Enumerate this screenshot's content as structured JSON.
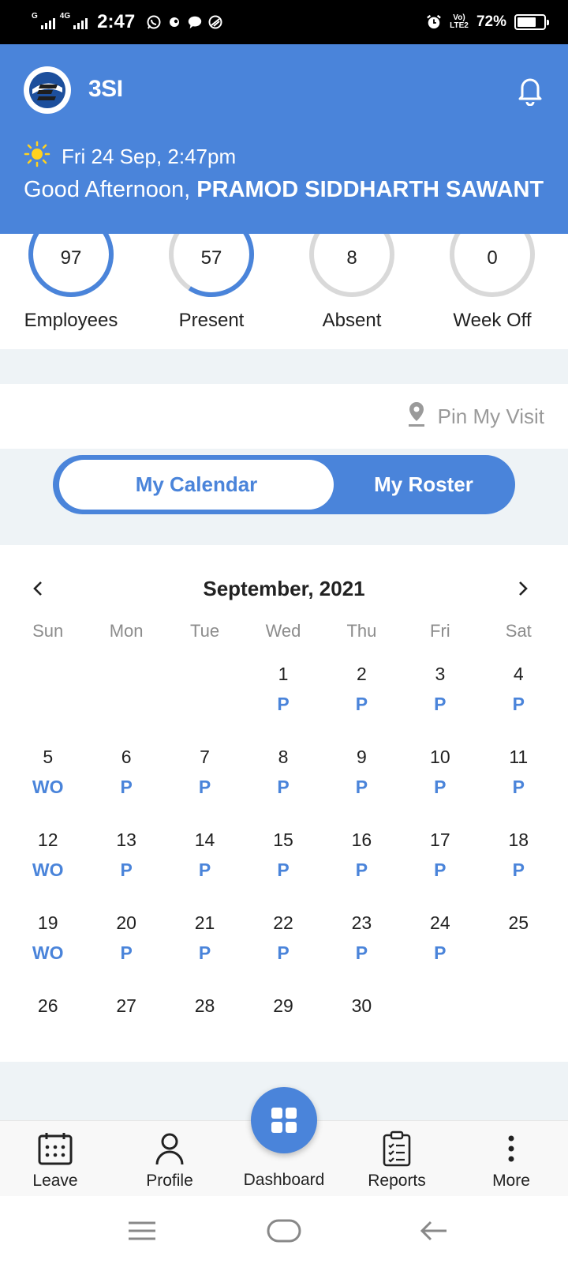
{
  "status_bar": {
    "network_1": "G",
    "network_2": "4G",
    "time": "2:47",
    "volte": "Vo) LTE2",
    "battery": "72%",
    "battery_level": 0.72
  },
  "header": {
    "app_name": "3SI",
    "date_time": "Fri 24 Sep, 2:47pm",
    "greeting": "Good Afternoon,",
    "user_name": "PRAMOD SIDDHARTH SAWANT",
    "accent_color": "#4a84da"
  },
  "stats": [
    {
      "value": "97",
      "label": "Employees",
      "fraction": 1.0
    },
    {
      "value": "57",
      "label": "Present",
      "fraction": 0.59
    },
    {
      "value": "8",
      "label": "Absent",
      "fraction": 0.0
    },
    {
      "value": "0",
      "label": "Week Off",
      "fraction": 0.0
    }
  ],
  "pin_visit": {
    "label": "Pin My Visit"
  },
  "toggle": {
    "active": "My Calendar",
    "inactive": "My Roster"
  },
  "calendar": {
    "title": "September, 2021",
    "weekdays": [
      "Sun",
      "Mon",
      "Tue",
      "Wed",
      "Thu",
      "Fri",
      "Sat"
    ],
    "weeks": [
      [
        {
          "d": "",
          "s": ""
        },
        {
          "d": "",
          "s": ""
        },
        {
          "d": "",
          "s": ""
        },
        {
          "d": "1",
          "s": "P"
        },
        {
          "d": "2",
          "s": "P"
        },
        {
          "d": "3",
          "s": "P"
        },
        {
          "d": "4",
          "s": "P"
        }
      ],
      [
        {
          "d": "5",
          "s": "WO"
        },
        {
          "d": "6",
          "s": "P"
        },
        {
          "d": "7",
          "s": "P"
        },
        {
          "d": "8",
          "s": "P"
        },
        {
          "d": "9",
          "s": "P"
        },
        {
          "d": "10",
          "s": "P"
        },
        {
          "d": "11",
          "s": "P"
        }
      ],
      [
        {
          "d": "12",
          "s": "WO"
        },
        {
          "d": "13",
          "s": "P"
        },
        {
          "d": "14",
          "s": "P"
        },
        {
          "d": "15",
          "s": "P"
        },
        {
          "d": "16",
          "s": "P"
        },
        {
          "d": "17",
          "s": "P"
        },
        {
          "d": "18",
          "s": "P"
        }
      ],
      [
        {
          "d": "19",
          "s": "WO"
        },
        {
          "d": "20",
          "s": "P"
        },
        {
          "d": "21",
          "s": "P"
        },
        {
          "d": "22",
          "s": "P"
        },
        {
          "d": "23",
          "s": "P"
        },
        {
          "d": "24",
          "s": "P"
        },
        {
          "d": "25",
          "s": ""
        }
      ],
      [
        {
          "d": "26",
          "s": ""
        },
        {
          "d": "27",
          "s": ""
        },
        {
          "d": "28",
          "s": ""
        },
        {
          "d": "29",
          "s": ""
        },
        {
          "d": "30",
          "s": ""
        },
        {
          "d": "",
          "s": ""
        },
        {
          "d": "",
          "s": ""
        }
      ]
    ]
  },
  "bottom_nav": {
    "leave": "Leave",
    "profile": "Profile",
    "dashboard": "Dashboard",
    "reports": "Reports",
    "more": "More"
  }
}
